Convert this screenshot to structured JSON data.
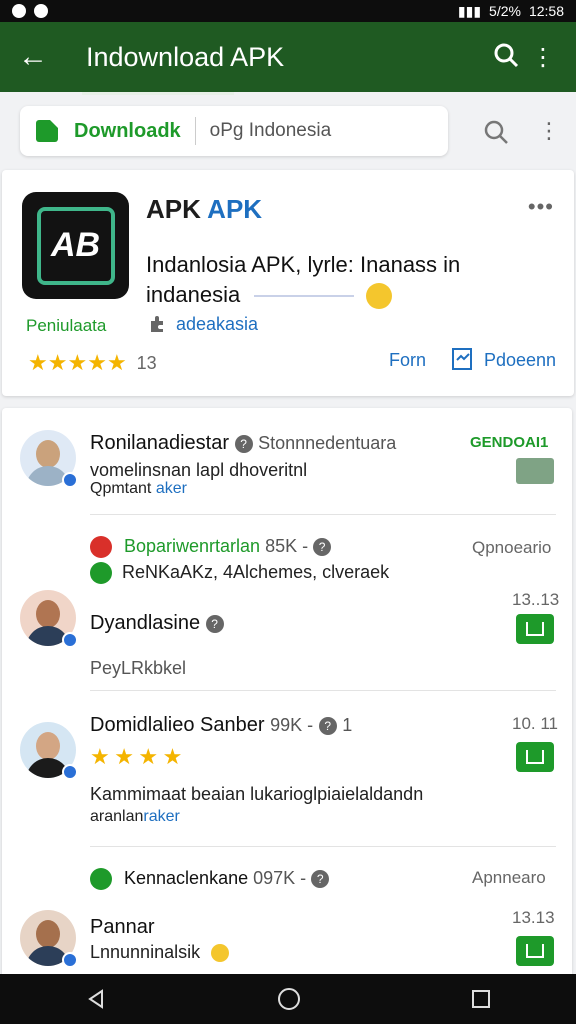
{
  "app_bar": {
    "title": "Indownload APK"
  },
  "search": {
    "label": "Downloadk",
    "query": "oPg Indonesia"
  },
  "app": {
    "name_a": "APK",
    "name_b": "APK",
    "logo_text": "AB",
    "description_1": "Indanlosia APK, lyrle: Inanass in",
    "description_2": "indanesia",
    "developer_label": "Peniulaata",
    "developer_link": "adeakasia",
    "rating_count": "13",
    "form_link": "Forn",
    "pdf_link": "Pdoeenn"
  },
  "reviews": [
    {
      "name": "Ronilanadiestar",
      "meta": "Stonnnedentuara",
      "badge": "GENDOAI1",
      "text_1": "vomelinsnan lapl dhoveritnl",
      "text_2": "Qpmtant",
      "text_2_link": "aker"
    },
    {
      "sub_name": "Bopariwenrtarlan",
      "sub_meta": "85K -",
      "sub_side": "Qpnoeario",
      "sub_text": "ReNKaAKz, 4Alchemes, clveraek",
      "name": "Dyandlasine",
      "side": "13..13",
      "text_1": "PeyLRkbkel"
    },
    {
      "name": "Domidlalieo Sanber",
      "meta": "99K -",
      "meta_count": "1",
      "side": "10. 11",
      "text_1": "Kammimaat beaian  lukarioglpiaielaldandn",
      "text_2": "aranlan",
      "text_2_link": "raker"
    },
    {
      "sub_name": "Kennaclenkane",
      "sub_meta": "097K -",
      "sub_side": "Apnnearo",
      "name": "Pannar",
      "side": "13.13",
      "text_1": "Lnnunninalsik"
    }
  ]
}
